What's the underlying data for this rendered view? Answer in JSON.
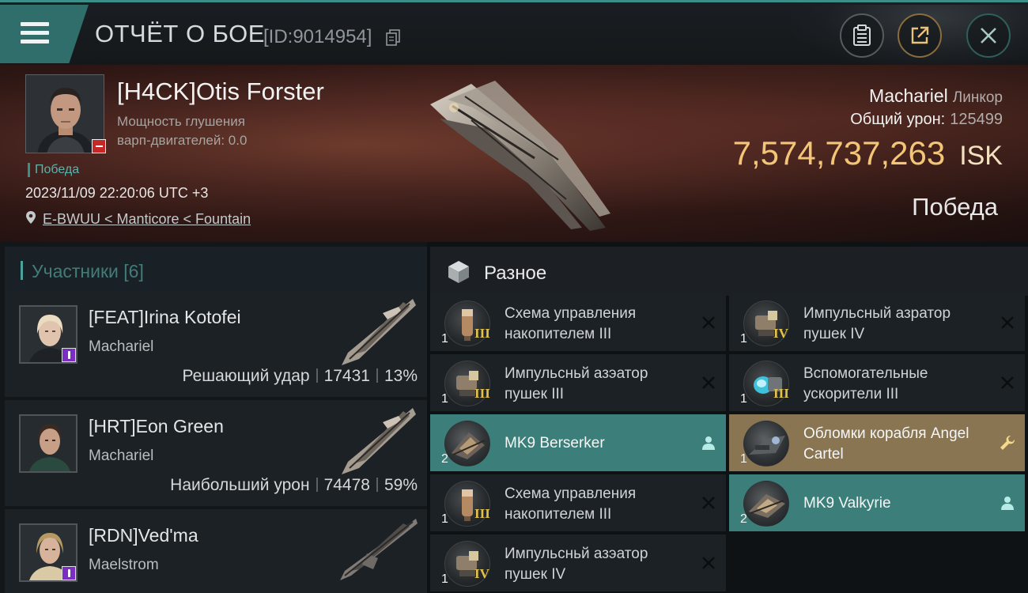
{
  "topbar": {
    "title": "ОТЧЁТ О БОЕ",
    "id_text": "[ID:9014954]"
  },
  "victim": {
    "name": "[H4CK]Otis Forster",
    "jam_line1": "Мощность глушения",
    "jam_line2": "варп-двигателей: 0.0",
    "result": "Победа",
    "datetime": "2023/11/09 22:20:06 UTC +3",
    "location": "E-BWUU < Manticore < Fountain",
    "ship": "Machariel",
    "ship_class": "Линкор",
    "damage_label": "Общий урон:",
    "damage_value": "125499",
    "isk_value": "7,574,737,263",
    "isk_currency": "ISK",
    "outcome": "Победа"
  },
  "participants": {
    "header": "Участники [6]",
    "items": [
      {
        "name": "[FEAT]Irina Kotofei",
        "ship": "Machariel",
        "role": "Решающий удар",
        "damage": "17431",
        "percent": "13%",
        "has_stats": true
      },
      {
        "name": "[HRT]Eon Green",
        "ship": "Machariel",
        "role": "Наибольший урон",
        "damage": "74478",
        "percent": "59%",
        "has_stats": true
      },
      {
        "name": "[RDN]Ved'ma",
        "ship": "Maelstrom",
        "role": "",
        "damage": "",
        "percent": "",
        "has_stats": false
      }
    ]
  },
  "misc": {
    "header": "Разное",
    "items": [
      {
        "name": "Схема управления накопителем III",
        "qty": "1",
        "tier": "III",
        "state": "destroyed",
        "color": "#1c2125"
      },
      {
        "name": "Импульсный азратор пушек IV",
        "qty": "1",
        "tier": "IV",
        "state": "destroyed",
        "color": "#1c2125"
      },
      {
        "name": "Импульсньй азэатор пушек III",
        "qty": "1",
        "tier": "III",
        "state": "destroyed",
        "color": "#1c2125"
      },
      {
        "name": "Вспомогательные ускорители III",
        "qty": "1",
        "tier": "III",
        "state": "destroyed",
        "color": "#1c2125"
      },
      {
        "name": "MK9 Berserker",
        "qty": "2",
        "tier": "",
        "state": "dropped-pilot",
        "color": "#3c7f7a"
      },
      {
        "name": "Обломки корабля Angel Cartel",
        "qty": "1",
        "tier": "",
        "state": "salvage",
        "color": "#8a7552"
      },
      {
        "name": "Схема управления накопителем III",
        "qty": "1",
        "tier": "III",
        "state": "destroyed",
        "color": "#1c2125"
      },
      {
        "name": "MK9 Valkyrie",
        "qty": "2",
        "tier": "",
        "state": "dropped-pilot",
        "color": "#3c7f7a"
      },
      {
        "name": "Импульсньй азэатор пушек IV",
        "qty": "1",
        "tier": "IV",
        "state": "destroyed",
        "color": "#1c2125"
      }
    ]
  },
  "icons": {
    "menu": "hamburger-icon",
    "copy": "copy-icon",
    "clipboard": "clipboard-icon",
    "share": "share-icon",
    "close": "close-icon",
    "location": "location-pin-icon",
    "cube": "cube-icon",
    "destroyed": "x-mark-icon",
    "dropped": "person-icon",
    "salvage": "wrench-icon"
  },
  "colors": {
    "accent": "#3c8f89",
    "isk": "#f3c677",
    "tier": "#e2c24a",
    "dropped_bg": "#3c7f7a",
    "salvage_bg": "#8a7552"
  }
}
